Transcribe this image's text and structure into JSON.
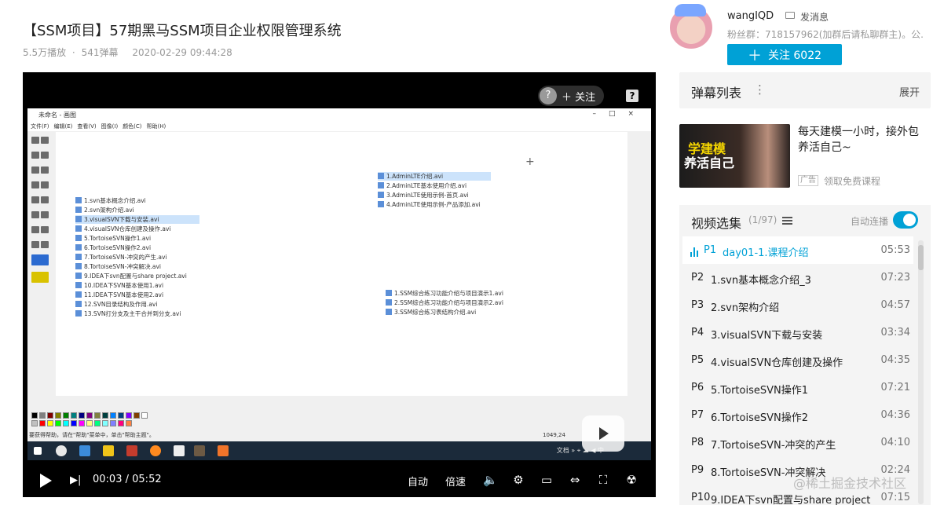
{
  "video": {
    "title": "【SSM项目】57期黑马SSM项目企业权限管理系统",
    "views": "5.5万播放",
    "sep": "·",
    "danmaku_count": "541弹幕",
    "date": "2020-02-29 09:44:28"
  },
  "player": {
    "follow_label": "关注",
    "help_glyph": "?",
    "current_time": "00:03",
    "time_sep": "/",
    "total_time": "05:52",
    "auto_label": "自动",
    "speed_label": "倍速"
  },
  "screen": {
    "app_title": "未命名 - 画图",
    "menus": [
      "文件(F)",
      "编辑(E)",
      "查看(V)",
      "图像(I)",
      "颜色(C)",
      "帮助(H)"
    ],
    "status_text": "要获得帮助，请在\"帮助\"菜单中，单击\"帮助主题\"。",
    "status_pos": "1049,24",
    "tray_text": "文档",
    "tray_lang": "中",
    "left_files": [
      "1.svn基本概念介绍.avi",
      "2.svn架构介绍.avi",
      "3.visualSVN下载与安装.avi",
      "4.visualSVN仓库创建及操作.avi",
      "5.TortoiseSVN操作1.avi",
      "6.TortoiseSVN操作2.avi",
      "7.TortoiseSVN-冲突的产生.avi",
      "8.TortoiseSVN-冲突解决.avi",
      "9.IDEA下svn配置与share project.avi",
      "10.IDEA下SVN基本使用1.avi",
      "11.IDEA下SVN基本使用2.avi",
      "12.SVN目录结构及作用.avi",
      "13.SVN打分支及主干合并到分支.avi"
    ],
    "right_files_a": [
      "1.AdminLTE介绍.avi",
      "2.AdminLTE基本使用介绍.avi",
      "3.AdminLTE使用示例-首页.avi",
      "4.AdminLTE使用示例-产品添加.avi"
    ],
    "right_files_b": [
      "1.SSM综合练习功能介绍与项目演示1.avi",
      "2.SSM综合练习功能介绍与项目演示2.avi",
      "3.SSM综合练习表结构介绍.avi"
    ]
  },
  "uploader": {
    "name": "wangIQD",
    "message_label": "发消息",
    "fans_text": "粉丝群：718157962(加群后请私聊群主)。公...",
    "follow_label": "关注 6022"
  },
  "danmaku_panel": {
    "title": "弹幕列表",
    "more": "⋮",
    "expand": "展开"
  },
  "ad": {
    "image_line1": "学建模",
    "image_line2": "养活自己",
    "title": "每天建模一小时，接外包养活自己~",
    "tag": "广告",
    "link": "领取免费课程"
  },
  "playlist": {
    "title": "视频选集",
    "count": "(1/97)",
    "autoplay_label": "自动连播",
    "autoplay_on": true,
    "items": [
      {
        "num": "P1",
        "name": "day01-1.课程介绍",
        "dur": "05:53"
      },
      {
        "num": "P2",
        "name": "1.svn基本概念介绍_3",
        "dur": "07:23"
      },
      {
        "num": "P3",
        "name": "2.svn架构介绍",
        "dur": "04:57"
      },
      {
        "num": "P4",
        "name": "3.visualSVN下载与安装",
        "dur": "03:34"
      },
      {
        "num": "P5",
        "name": "4.visualSVN仓库创建及操作",
        "dur": "04:35"
      },
      {
        "num": "P6",
        "name": "5.TortoiseSVN操作1",
        "dur": "07:21"
      },
      {
        "num": "P7",
        "name": "6.TortoiseSVN操作2",
        "dur": "04:36"
      },
      {
        "num": "P8",
        "name": "7.TortoiseSVN-冲突的产生",
        "dur": "04:10"
      },
      {
        "num": "P9",
        "name": "8.TortoiseSVN-冲突解决",
        "dur": "02:24"
      },
      {
        "num": "P10",
        "name": "9.IDEA下svn配置与share project",
        "dur": "07:15"
      }
    ]
  },
  "watermark": "@稀土掘金技术社区"
}
